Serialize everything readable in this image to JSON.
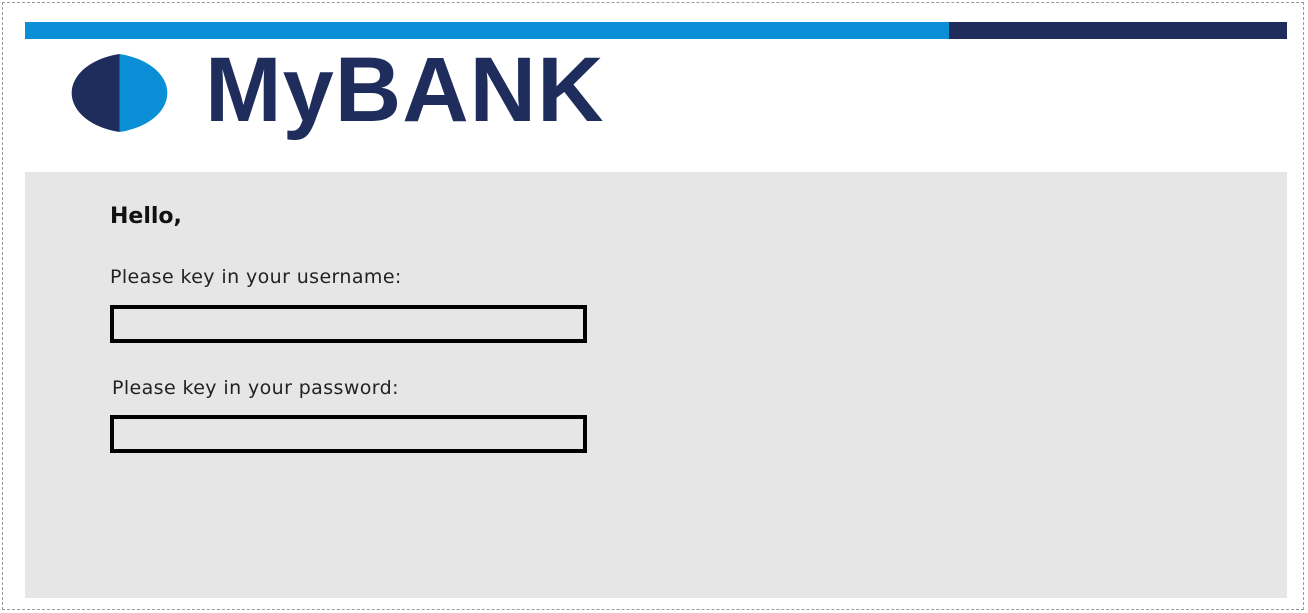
{
  "brand": {
    "name": "MyBANK",
    "light_blue": "#0a8fd6",
    "navy": "#1f2d5c",
    "logo_icon": "half-circle-logo-icon"
  },
  "login_panel": {
    "greeting": "Hello,",
    "username_label": "Please key in your username:",
    "username_value": "",
    "password_label": "Please key in your password:",
    "password_value": "",
    "panel_color": "#e6e6e6"
  }
}
